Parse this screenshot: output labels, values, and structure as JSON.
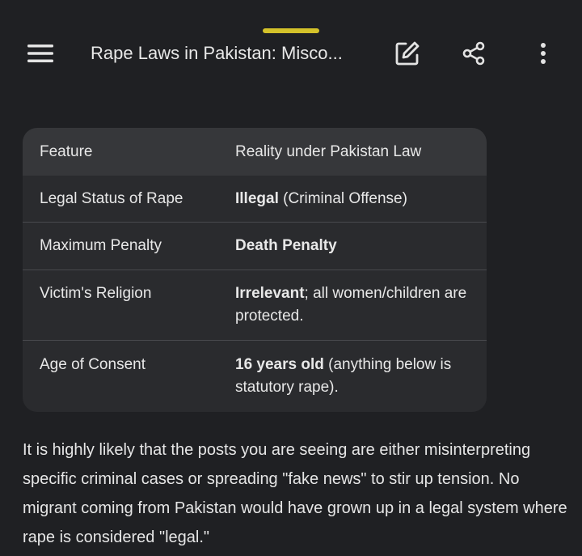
{
  "header": {
    "title": "Rape Laws in Pakistan: Misco..."
  },
  "table": {
    "columns": [
      "Feature",
      "Reality under Pakistan Law"
    ],
    "rows": [
      {
        "feature": "Legal Status of Rape",
        "bold": "Illegal",
        "rest": " (Criminal Offense)"
      },
      {
        "feature": "Maximum Penalty",
        "bold": "Death Penalty",
        "rest": ""
      },
      {
        "feature": "Victim's Religion",
        "bold": "Irrelevant",
        "rest": "; all women/children are protected."
      },
      {
        "feature": "Age of Consent",
        "bold": "16 years old",
        "rest": " (anything below is statutory rape)."
      }
    ]
  },
  "paragraph": "It is highly likely that the posts you are seeing are either misinterpreting specific criminal cases or spreading \"fake news\" to stir up tension. No migrant coming from Pakistan would have grown up in a legal system where rape is considered \"legal.\"",
  "colors": {
    "background": "#1f2023",
    "accent_handle": "#d4c22a",
    "table_bg": "#2a2b2e",
    "table_header_bg": "#36373a"
  },
  "icons": [
    "menu-icon",
    "edit-icon",
    "share-icon",
    "more-vert-icon"
  ]
}
